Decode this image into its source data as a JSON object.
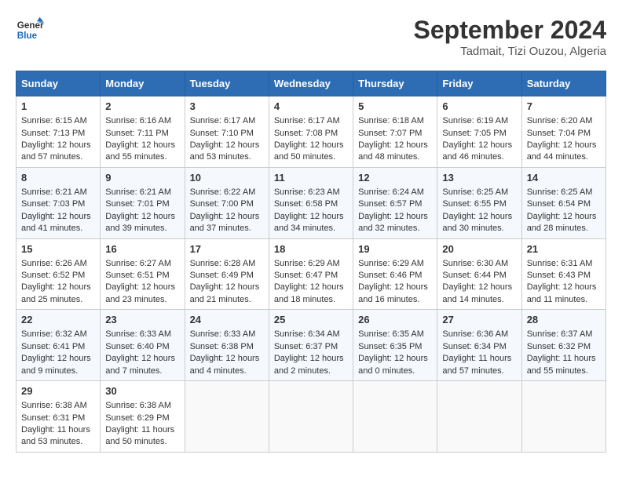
{
  "logo": {
    "line1": "General",
    "line2": "Blue"
  },
  "title": "September 2024",
  "subtitle": "Tadmait, Tizi Ouzou, Algeria",
  "days_of_week": [
    "Sunday",
    "Monday",
    "Tuesday",
    "Wednesday",
    "Thursday",
    "Friday",
    "Saturday"
  ],
  "weeks": [
    [
      {
        "day": "1",
        "sunrise": "6:15 AM",
        "sunset": "7:13 PM",
        "daylight": "12 hours and 57 minutes."
      },
      {
        "day": "2",
        "sunrise": "6:16 AM",
        "sunset": "7:11 PM",
        "daylight": "12 hours and 55 minutes."
      },
      {
        "day": "3",
        "sunrise": "6:17 AM",
        "sunset": "7:10 PM",
        "daylight": "12 hours and 53 minutes."
      },
      {
        "day": "4",
        "sunrise": "6:17 AM",
        "sunset": "7:08 PM",
        "daylight": "12 hours and 50 minutes."
      },
      {
        "day": "5",
        "sunrise": "6:18 AM",
        "sunset": "7:07 PM",
        "daylight": "12 hours and 48 minutes."
      },
      {
        "day": "6",
        "sunrise": "6:19 AM",
        "sunset": "7:05 PM",
        "daylight": "12 hours and 46 minutes."
      },
      {
        "day": "7",
        "sunrise": "6:20 AM",
        "sunset": "7:04 PM",
        "daylight": "12 hours and 44 minutes."
      }
    ],
    [
      {
        "day": "8",
        "sunrise": "6:21 AM",
        "sunset": "7:03 PM",
        "daylight": "12 hours and 41 minutes."
      },
      {
        "day": "9",
        "sunrise": "6:21 AM",
        "sunset": "7:01 PM",
        "daylight": "12 hours and 39 minutes."
      },
      {
        "day": "10",
        "sunrise": "6:22 AM",
        "sunset": "7:00 PM",
        "daylight": "12 hours and 37 minutes."
      },
      {
        "day": "11",
        "sunrise": "6:23 AM",
        "sunset": "6:58 PM",
        "daylight": "12 hours and 34 minutes."
      },
      {
        "day": "12",
        "sunrise": "6:24 AM",
        "sunset": "6:57 PM",
        "daylight": "12 hours and 32 minutes."
      },
      {
        "day": "13",
        "sunrise": "6:25 AM",
        "sunset": "6:55 PM",
        "daylight": "12 hours and 30 minutes."
      },
      {
        "day": "14",
        "sunrise": "6:25 AM",
        "sunset": "6:54 PM",
        "daylight": "12 hours and 28 minutes."
      }
    ],
    [
      {
        "day": "15",
        "sunrise": "6:26 AM",
        "sunset": "6:52 PM",
        "daylight": "12 hours and 25 minutes."
      },
      {
        "day": "16",
        "sunrise": "6:27 AM",
        "sunset": "6:51 PM",
        "daylight": "12 hours and 23 minutes."
      },
      {
        "day": "17",
        "sunrise": "6:28 AM",
        "sunset": "6:49 PM",
        "daylight": "12 hours and 21 minutes."
      },
      {
        "day": "18",
        "sunrise": "6:29 AM",
        "sunset": "6:47 PM",
        "daylight": "12 hours and 18 minutes."
      },
      {
        "day": "19",
        "sunrise": "6:29 AM",
        "sunset": "6:46 PM",
        "daylight": "12 hours and 16 minutes."
      },
      {
        "day": "20",
        "sunrise": "6:30 AM",
        "sunset": "6:44 PM",
        "daylight": "12 hours and 14 minutes."
      },
      {
        "day": "21",
        "sunrise": "6:31 AM",
        "sunset": "6:43 PM",
        "daylight": "12 hours and 11 minutes."
      }
    ],
    [
      {
        "day": "22",
        "sunrise": "6:32 AM",
        "sunset": "6:41 PM",
        "daylight": "12 hours and 9 minutes."
      },
      {
        "day": "23",
        "sunrise": "6:33 AM",
        "sunset": "6:40 PM",
        "daylight": "12 hours and 7 minutes."
      },
      {
        "day": "24",
        "sunrise": "6:33 AM",
        "sunset": "6:38 PM",
        "daylight": "12 hours and 4 minutes."
      },
      {
        "day": "25",
        "sunrise": "6:34 AM",
        "sunset": "6:37 PM",
        "daylight": "12 hours and 2 minutes."
      },
      {
        "day": "26",
        "sunrise": "6:35 AM",
        "sunset": "6:35 PM",
        "daylight": "12 hours and 0 minutes."
      },
      {
        "day": "27",
        "sunrise": "6:36 AM",
        "sunset": "6:34 PM",
        "daylight": "11 hours and 57 minutes."
      },
      {
        "day": "28",
        "sunrise": "6:37 AM",
        "sunset": "6:32 PM",
        "daylight": "11 hours and 55 minutes."
      }
    ],
    [
      {
        "day": "29",
        "sunrise": "6:38 AM",
        "sunset": "6:31 PM",
        "daylight": "11 hours and 53 minutes."
      },
      {
        "day": "30",
        "sunrise": "6:38 AM",
        "sunset": "6:29 PM",
        "daylight": "11 hours and 50 minutes."
      },
      null,
      null,
      null,
      null,
      null
    ]
  ]
}
